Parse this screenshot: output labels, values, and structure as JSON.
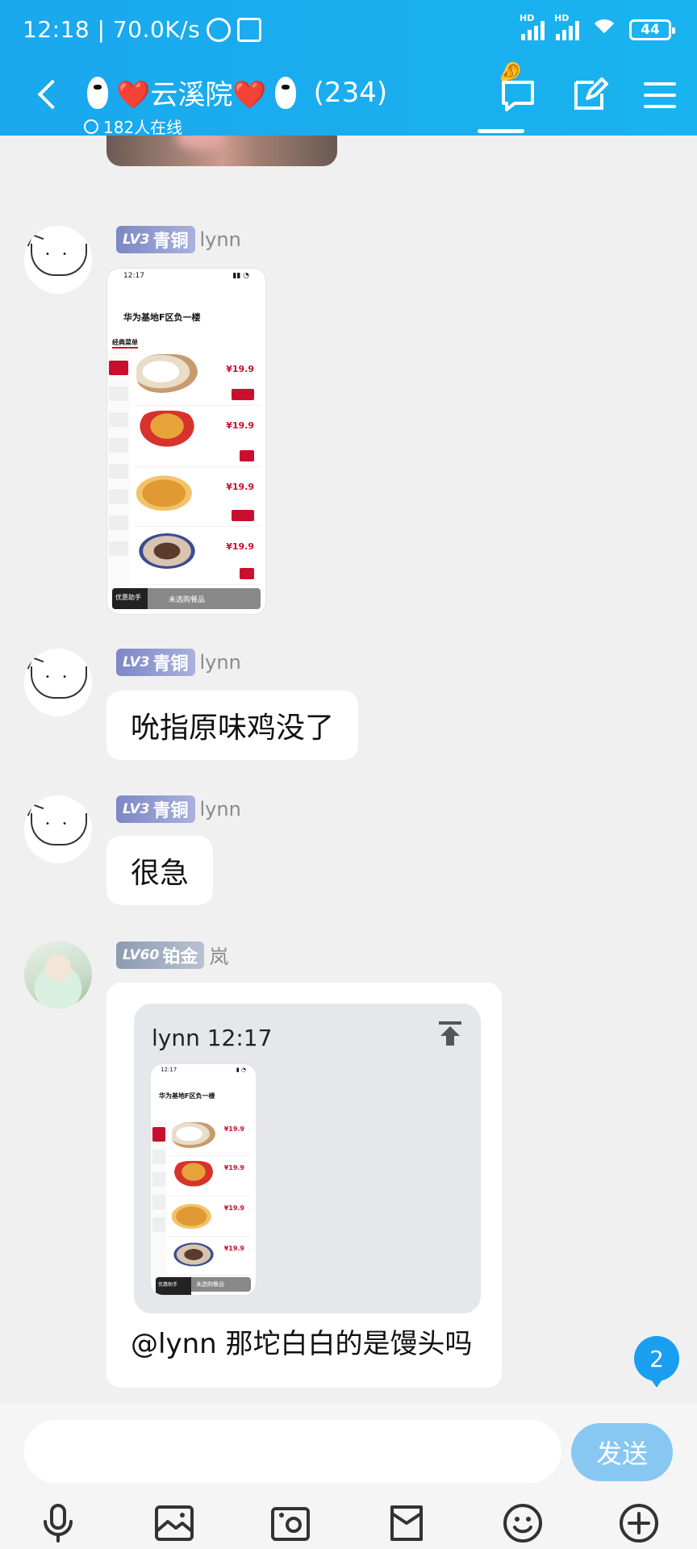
{
  "status_bar": {
    "time_speed": "12:18 | 70.0K/s",
    "network1": "HD",
    "network2": "HD",
    "battery": "44"
  },
  "header": {
    "title": "❤️云溪院❤️",
    "member_count": "(234)",
    "online": "182人在线",
    "icons": [
      "back-icon",
      "ear-icon",
      "chat-bubble-icon",
      "edit-icon",
      "menu-icon"
    ]
  },
  "messages": [
    {
      "level_tag": "LV3",
      "title_tag": "青铜",
      "name": "lynn",
      "type": "image",
      "image": {
        "time": "12:17",
        "store_title": "华为基地F区负一楼",
        "tab": "经典菜单",
        "prices": [
          "¥19.9",
          "¥19.9",
          "¥19.9",
          "¥19.9"
        ],
        "bottom_bar": "优惠助手",
        "bottom_bar2": "未选购餐品"
      }
    },
    {
      "level_tag": "LV3",
      "title_tag": "青铜",
      "name": "lynn",
      "type": "text",
      "text": "吮指原味鸡没了"
    },
    {
      "level_tag": "LV3",
      "title_tag": "青铜",
      "name": "lynn",
      "type": "text",
      "text": "很急"
    },
    {
      "level_tag": "LV60",
      "title_tag": "铂金",
      "name": "岚",
      "type": "reply",
      "quote_header": "lynn 12:17",
      "text": "@lynn 那坨白白的是馒头吗"
    }
  ],
  "unread_count": "2",
  "composer": {
    "placeholder": "",
    "send_label": "发送"
  },
  "toolbar": [
    "microphone-icon",
    "image-icon",
    "camera-icon",
    "pocket-icon",
    "emoji-icon",
    "plus-icon"
  ],
  "colors": {
    "header_bg": "#1aa7ee",
    "send_button": "#87c7f2",
    "unread_badge": "#1a9ff0",
    "bronze_badge": "#7c87c4",
    "platinum_badge": "#8d9bb1",
    "kfc_red": "#c8102e"
  }
}
